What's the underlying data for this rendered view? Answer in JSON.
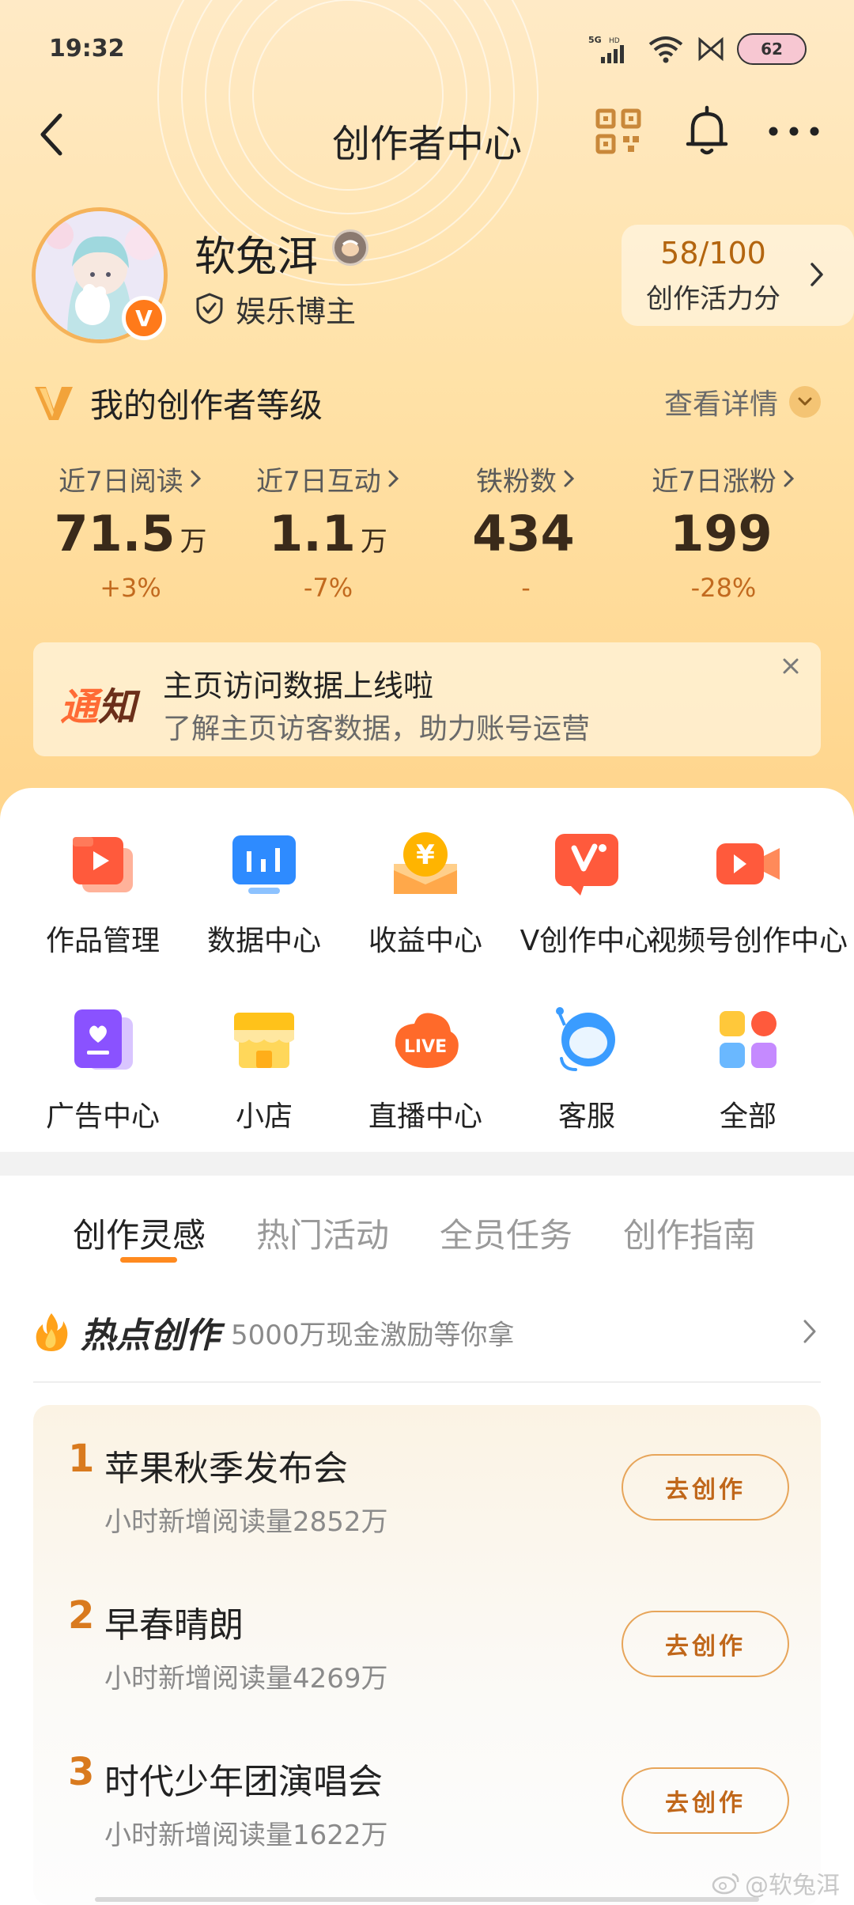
{
  "status_bar": {
    "time": "19:32",
    "network": "5G",
    "hd": "HD",
    "battery": "62"
  },
  "nav": {
    "title": "创作者中心"
  },
  "profile": {
    "username": "软兔洱",
    "role": "娱乐博主",
    "verify_mark": "V",
    "vitality_score": "58/100",
    "vitality_label": "创作活力分"
  },
  "level": {
    "title": "我的创作者等级",
    "detail_link": "查看详情"
  },
  "stats": [
    {
      "label": "近7日阅读",
      "value": "71.5",
      "unit": "万",
      "change": "+3%"
    },
    {
      "label": "近7日互动",
      "value": "1.1",
      "unit": "万",
      "change": "-7%"
    },
    {
      "label": "铁粉数",
      "value": "434",
      "unit": "",
      "change": "-"
    },
    {
      "label": "近7日涨粉",
      "value": "199",
      "unit": "",
      "change": "-28%"
    }
  ],
  "notice": {
    "tag_a": "通",
    "tag_b": "知",
    "title": "主页访问数据上线啦",
    "subtitle": "了解主页访客数据，助力账号运营"
  },
  "grid": [
    {
      "label": "作品管理",
      "icon": "works-icon"
    },
    {
      "label": "数据中心",
      "icon": "data-icon"
    },
    {
      "label": "收益中心",
      "icon": "income-icon"
    },
    {
      "label": "V创作中心",
      "icon": "v-create-icon"
    },
    {
      "label": "视频号创作中心",
      "icon": "video-icon"
    },
    {
      "label": "广告中心",
      "icon": "ad-icon"
    },
    {
      "label": "小店",
      "icon": "shop-icon"
    },
    {
      "label": "直播中心",
      "icon": "live-icon"
    },
    {
      "label": "客服",
      "icon": "service-icon"
    },
    {
      "label": "全部",
      "icon": "all-icon"
    }
  ],
  "live_badge": "LIVE",
  "tabs": [
    {
      "label": "创作灵感",
      "active": true
    },
    {
      "label": "热门活动",
      "active": false
    },
    {
      "label": "全员任务",
      "active": false
    },
    {
      "label": "创作指南",
      "active": false
    }
  ],
  "hot": {
    "title": "热点创作",
    "subtitle": "5000万现金激励等你拿",
    "items": [
      {
        "rank": "1",
        "name": "苹果秋季发布会",
        "reads": "小时新增阅读量2852万",
        "button": "去创作"
      },
      {
        "rank": "2",
        "name": "早春晴朗",
        "reads": "小时新增阅读量4269万",
        "button": "去创作"
      },
      {
        "rank": "3",
        "name": "时代少年团演唱会",
        "reads": "小时新增阅读量1622万",
        "button": "去创作"
      }
    ]
  },
  "watermark": "@软兔洱",
  "colors": {
    "accent": "#ff8a1f",
    "hero_top": "#ffeac6",
    "hero_bottom": "#ffd58c",
    "rank": "#d97a1e"
  }
}
